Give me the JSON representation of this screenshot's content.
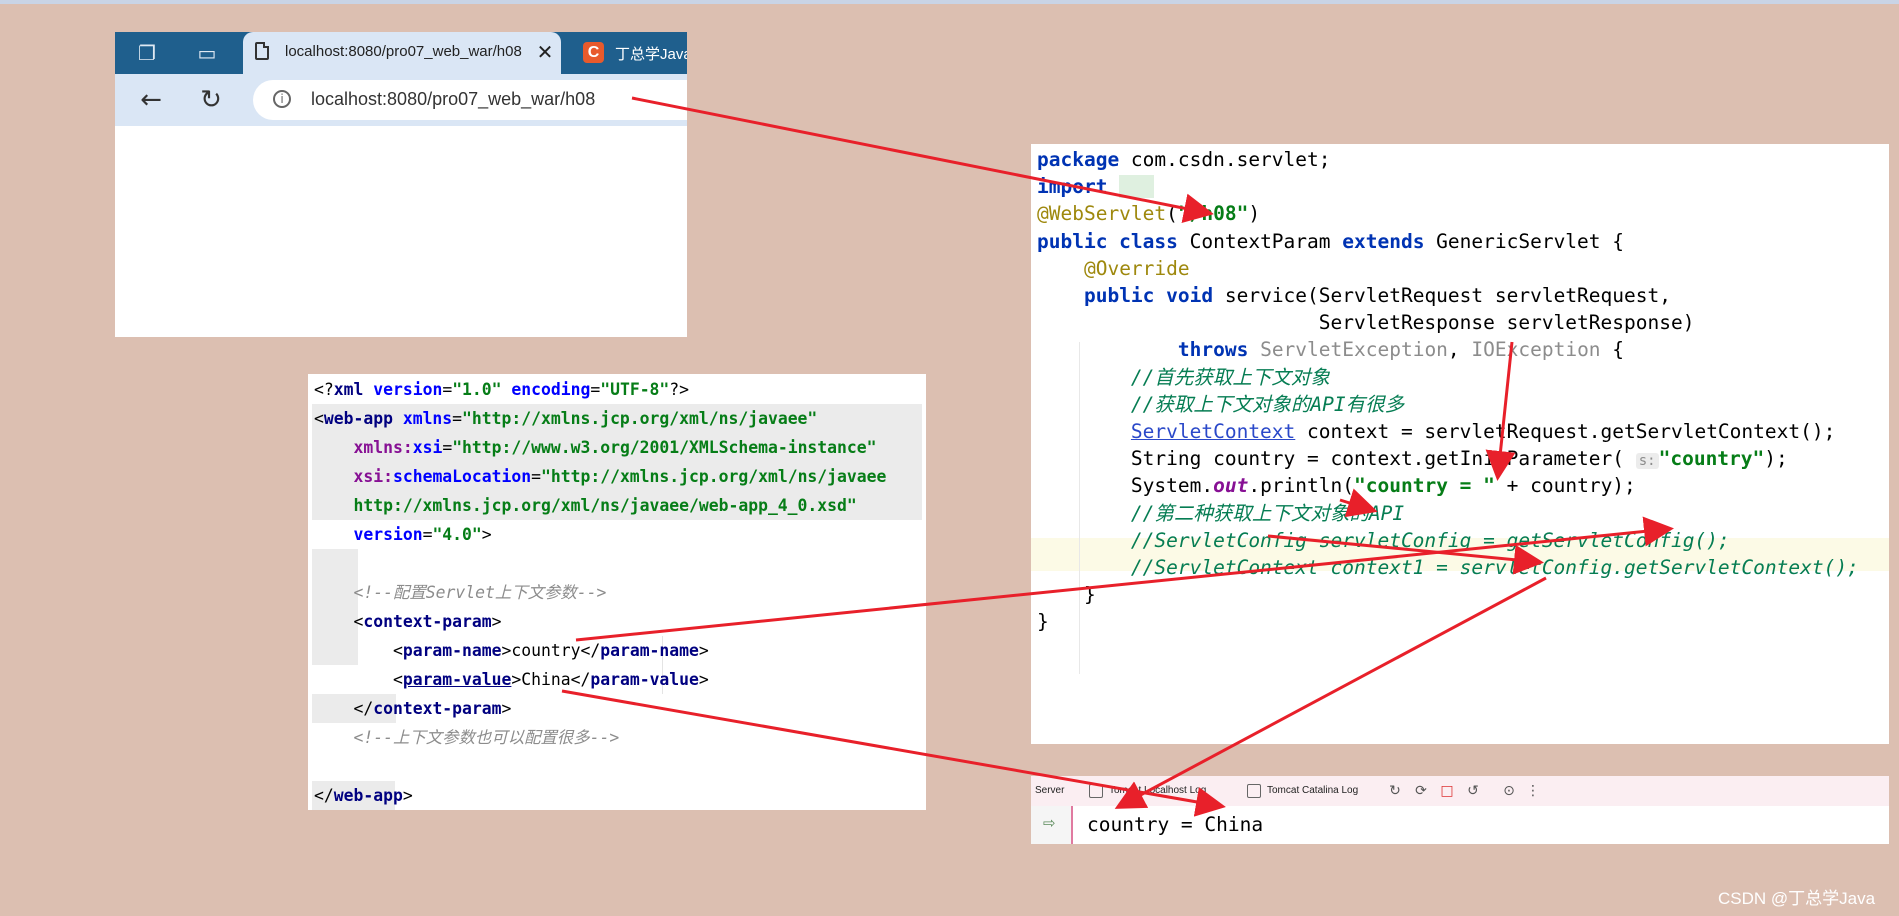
{
  "browser": {
    "tab_title": "localhost:8080/pro07_web_war/h08",
    "tab2_title": "丁总学Java",
    "tab2_favicon": "C",
    "url": "localhost:8080/pro07_web_war/h08",
    "icons": [
      "workspaces-icon",
      "tab-actions-icon",
      "document-icon",
      "close-icon",
      "back-icon",
      "reload-icon",
      "info-icon"
    ]
  },
  "xml": {
    "lines": [
      [
        [
          "br",
          "<?"
        ],
        [
          "tag",
          "xml "
        ],
        [
          "an",
          "version"
        ],
        [
          "br",
          "="
        ],
        [
          "av",
          "\"1.0\""
        ],
        [
          "an",
          " encoding"
        ],
        [
          "br",
          "="
        ],
        [
          "av",
          "\"UTF-8\""
        ],
        [
          "br",
          "?>"
        ]
      ],
      [
        [
          "br",
          "<"
        ],
        [
          "tag",
          "web-app "
        ],
        [
          "an",
          "xmlns"
        ],
        [
          "br",
          "="
        ],
        [
          "av",
          "\"http://xmlns.jcp.org/xml/ns/javaee\""
        ]
      ],
      [
        [
          "tx",
          "    "
        ],
        [
          "ns",
          "xmlns:"
        ],
        [
          "an",
          "xsi"
        ],
        [
          "br",
          "="
        ],
        [
          "av",
          "\"http://www.w3.org/2001/XMLSchema-instance\""
        ]
      ],
      [
        [
          "tx",
          "    "
        ],
        [
          "ns",
          "xsi:"
        ],
        [
          "an",
          "schemaLocation"
        ],
        [
          "br",
          "="
        ],
        [
          "av",
          "\"http://xmlns.jcp.org/xml/ns/javaee"
        ]
      ],
      [
        [
          "tx",
          "    "
        ],
        [
          "av",
          "http://xmlns.jcp.org/xml/ns/javaee/web-app_4_0.xsd\""
        ]
      ],
      [
        [
          "tx",
          "    "
        ],
        [
          "an",
          "version"
        ],
        [
          "br",
          "="
        ],
        [
          "av",
          "\"4.0\""
        ],
        [
          "br",
          ">"
        ]
      ],
      [],
      [
        [
          "tx",
          "    "
        ],
        [
          "cm",
          "<!--配置Servlet上下文参数-->"
        ]
      ],
      [
        [
          "tx",
          "    "
        ],
        [
          "br",
          "<"
        ],
        [
          "tag",
          "context-param"
        ],
        [
          "br",
          ">"
        ]
      ],
      [
        [
          "tx",
          "        "
        ],
        [
          "br",
          "<"
        ],
        [
          "tag",
          "param-name"
        ],
        [
          "br",
          ">"
        ],
        [
          "tx",
          "country"
        ],
        [
          "br",
          "</"
        ],
        [
          "tag",
          "param-name"
        ],
        [
          "br",
          ">"
        ]
      ],
      [
        [
          "tx",
          "        "
        ],
        [
          "br",
          "<"
        ],
        [
          "tag ul",
          "param-value"
        ],
        [
          "br",
          ">"
        ],
        [
          "tx",
          "China"
        ],
        [
          "br",
          "</"
        ],
        [
          "tag",
          "param-value"
        ],
        [
          "br",
          ">"
        ]
      ],
      [
        [
          "tx",
          "    "
        ],
        [
          "br",
          "</"
        ],
        [
          "tag",
          "context-param"
        ],
        [
          "br",
          ">"
        ]
      ],
      [
        [
          "tx",
          "    "
        ],
        [
          "cm",
          "<!--上下文参数也可以配置很多-->"
        ]
      ],
      [],
      [
        [
          "br",
          "</"
        ],
        [
          "tag",
          "web-app"
        ],
        [
          "br",
          ">"
        ]
      ]
    ]
  },
  "java": {
    "lines": [
      [
        [
          "kw",
          "package "
        ],
        [
          "ty",
          "com.csdn.servlet;"
        ]
      ],
      [
        [
          "kw",
          "import "
        ],
        [
          "imp",
          "..."
        ]
      ],
      [
        [
          "an",
          "@WebServlet"
        ],
        [
          "ty",
          "("
        ],
        [
          "st",
          "\"/h08\""
        ],
        [
          "ty",
          ")"
        ]
      ],
      [
        [
          "kw",
          "public class "
        ],
        [
          "ty",
          "ContextParam "
        ],
        [
          "kw",
          "extends "
        ],
        [
          "ty",
          "GenericServlet {"
        ]
      ],
      [
        [
          "ty",
          "    "
        ],
        [
          "an",
          "@Override"
        ]
      ],
      [
        [
          "ty",
          "    "
        ],
        [
          "kw",
          "public void "
        ],
        [
          "ty",
          "service(ServletRequest servletRequest,"
        ]
      ],
      [
        [
          "ty",
          "                        ServletResponse servletResponse)"
        ]
      ],
      [
        [
          "ty",
          "            "
        ],
        [
          "kw",
          "throws "
        ],
        [
          "gr",
          "ServletException"
        ],
        [
          "ty",
          ", "
        ],
        [
          "gr",
          "IOException"
        ],
        [
          "ty",
          " {"
        ]
      ],
      [
        [
          "ty",
          "        "
        ],
        [
          "cm",
          "//首先获取上下文对象"
        ]
      ],
      [
        [
          "ty",
          "        "
        ],
        [
          "cm",
          "//获取上下文对象的API有很多"
        ]
      ],
      [
        [
          "ty",
          "        "
        ],
        [
          "ln",
          "ServletContext"
        ],
        [
          "ty",
          " context = servletRequest.getServletContext();"
        ]
      ],
      [
        [
          "ty",
          "        String country = context.getInitParameter( "
        ],
        [
          "ih",
          "s:"
        ],
        [
          "st",
          "\"country\""
        ],
        [
          "ty",
          ");"
        ]
      ],
      [
        [
          "ty",
          "        System."
        ],
        [
          "fi",
          "out"
        ],
        [
          "ty",
          ".println("
        ],
        [
          "st",
          "\"country = \""
        ],
        [
          "ty",
          " + country);"
        ]
      ],
      [
        [
          "ty",
          "        "
        ],
        [
          "cm",
          "//第二种获取上下文对象的API"
        ]
      ],
      [
        [
          "ty",
          "        "
        ],
        [
          "cm",
          "//ServletConfig servletConfig = getServletConfig();"
        ]
      ],
      [
        [
          "ty",
          "        "
        ],
        [
          "cm",
          "//ServletContext context1 = servletConfig.getServletContext();"
        ]
      ],
      [
        [
          "ty",
          "    }"
        ]
      ],
      [
        [
          "ty",
          "}"
        ]
      ]
    ]
  },
  "run": {
    "tab_server": "Server",
    "tab_localhost": "Tomcat Localhost Log",
    "tab_catalina": "Tomcat Catalina Log",
    "output": "country = China",
    "icons": [
      "rerun-icon",
      "update-icon",
      "stop-icon",
      "restart-icon",
      "screenshot-icon",
      "more-icon"
    ]
  },
  "watermark": "CSDN @丁总学Java",
  "colors": {
    "background": "#dcbfb1",
    "arrow": "#e8202a",
    "tabbar": "#1f5f8d"
  }
}
